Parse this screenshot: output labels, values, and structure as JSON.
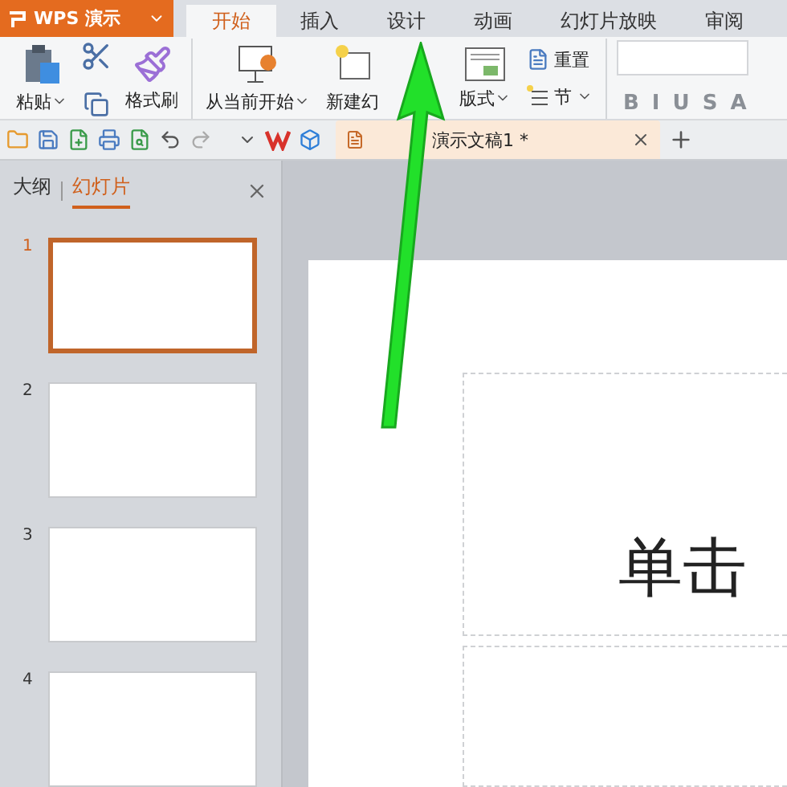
{
  "app_button": {
    "label": "WPS 演示"
  },
  "tabs": [
    {
      "label": "开始",
      "selected": true
    },
    {
      "label": "插入",
      "selected": false
    },
    {
      "label": "设计",
      "selected": false
    },
    {
      "label": "动画",
      "selected": false
    },
    {
      "label": "幻灯片放映",
      "selected": false
    },
    {
      "label": "审阅",
      "selected": false
    }
  ],
  "ribbon": {
    "paste": "粘贴",
    "format_painter": "格式刷",
    "from_current": "从当前开始",
    "new_slide": "新建幻",
    "layout": "版式",
    "reset": "重置",
    "section": "节",
    "format_buttons": [
      "B",
      "I",
      "U",
      "S",
      "A"
    ]
  },
  "document_tab": {
    "title": "演示文稿1 *"
  },
  "panel": {
    "tabs": [
      {
        "label": "大纲",
        "selected": false
      },
      {
        "label": "幻灯片",
        "selected": true
      }
    ],
    "thumbnails": [
      {
        "number": "1",
        "selected": true
      },
      {
        "number": "2",
        "selected": false
      },
      {
        "number": "3",
        "selected": false
      },
      {
        "number": "4",
        "selected": false
      }
    ]
  },
  "slide": {
    "title_text": "单击"
  }
}
